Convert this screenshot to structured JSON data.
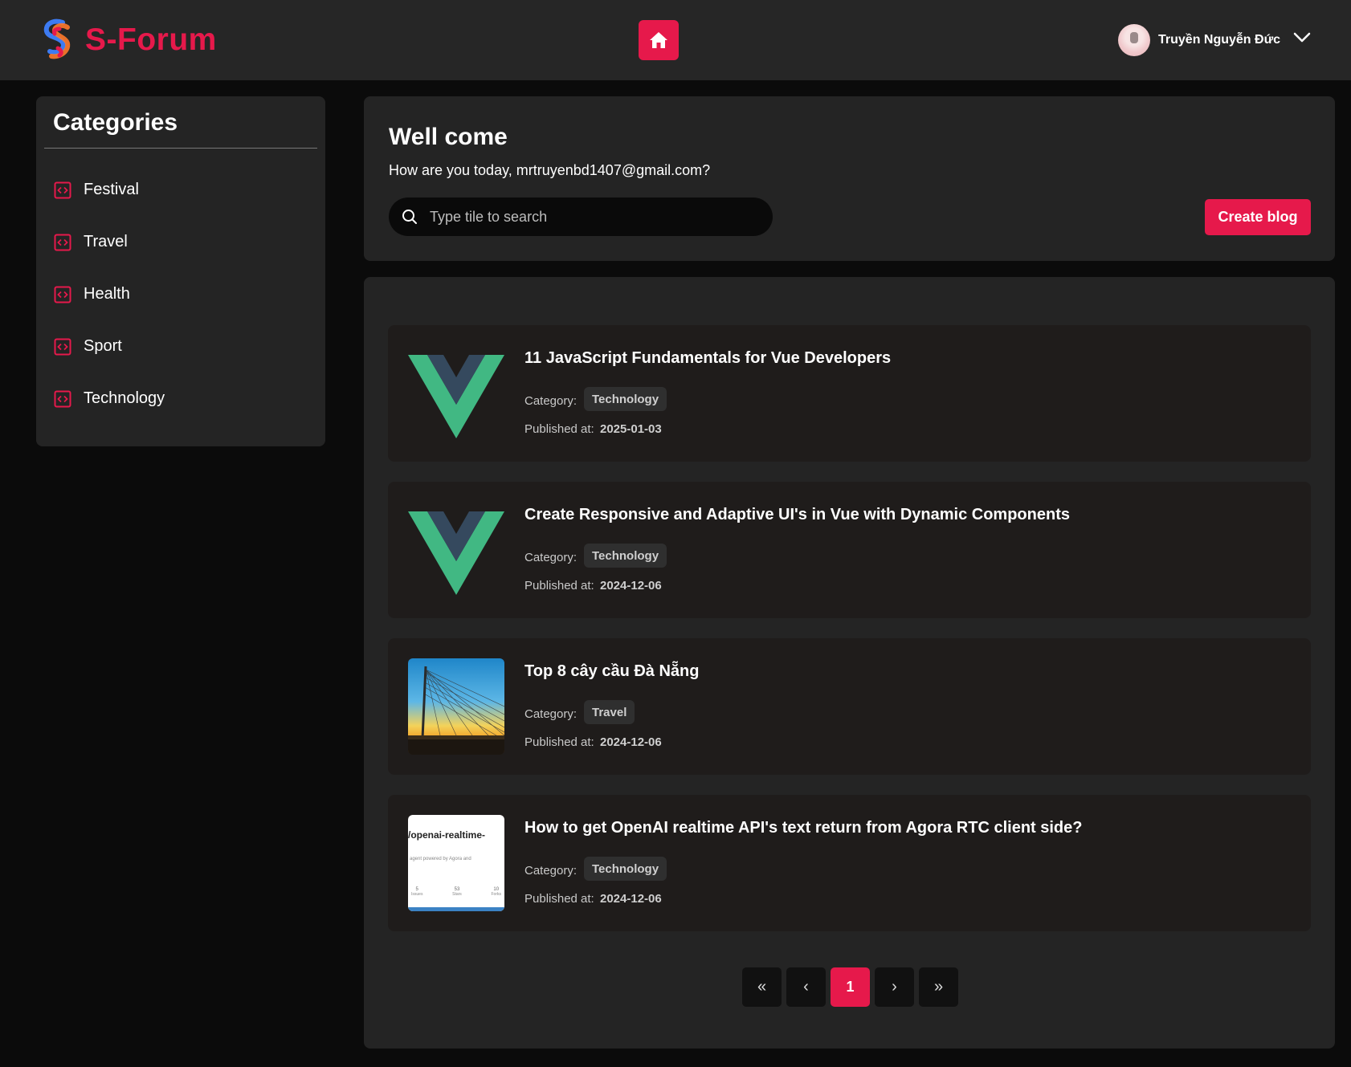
{
  "header": {
    "brand": "S-Forum",
    "user_name": "Truyền Nguyễn Đức",
    "accent_color": "#e6194b"
  },
  "sidebar": {
    "title": "Categories",
    "items": [
      {
        "label": "Festival"
      },
      {
        "label": "Travel"
      },
      {
        "label": "Health"
      },
      {
        "label": "Sport"
      },
      {
        "label": "Technology"
      }
    ]
  },
  "welcome": {
    "title": "Well come",
    "subtitle": "How are you today, mrtruyenbd1407@gmail.com?",
    "search_placeholder": "Type tile to search",
    "create_label": "Create blog"
  },
  "posts": [
    {
      "title": "11 JavaScript Fundamentals for Vue Developers",
      "category_label": "Category:",
      "category": "Technology",
      "published_label": "Published at:",
      "date": "2025-01-03",
      "thumbnail": "vue-logo"
    },
    {
      "title": "Create Responsive and Adaptive UI's in Vue with Dynamic Components",
      "category_label": "Category:",
      "category": "Technology",
      "published_label": "Published at:",
      "date": "2024-12-06",
      "thumbnail": "vue-logo"
    },
    {
      "title": "Top 8 cây cầu Đà Nẵng",
      "category_label": "Category:",
      "category": "Travel",
      "published_label": "Published at:",
      "date": "2024-12-06",
      "thumbnail": "bridge-photo"
    },
    {
      "title": "How to get OpenAI realtime API's text return from Agora RTC client side?",
      "category_label": "Category:",
      "category": "Technology",
      "published_label": "Published at:",
      "date": "2024-12-06",
      "thumbnail": "github-repo-card",
      "thumb_text": "/openai-realtime-",
      "thumb_subtext": "agent powered by Agora and",
      "thumb_stats": [
        "5",
        "53",
        "10"
      ],
      "thumb_stat_labels": [
        "Issues",
        "Stars",
        "Forks"
      ]
    }
  ],
  "pagination": {
    "first": "«",
    "prev": "‹",
    "current": "1",
    "next": "›",
    "last": "»"
  }
}
